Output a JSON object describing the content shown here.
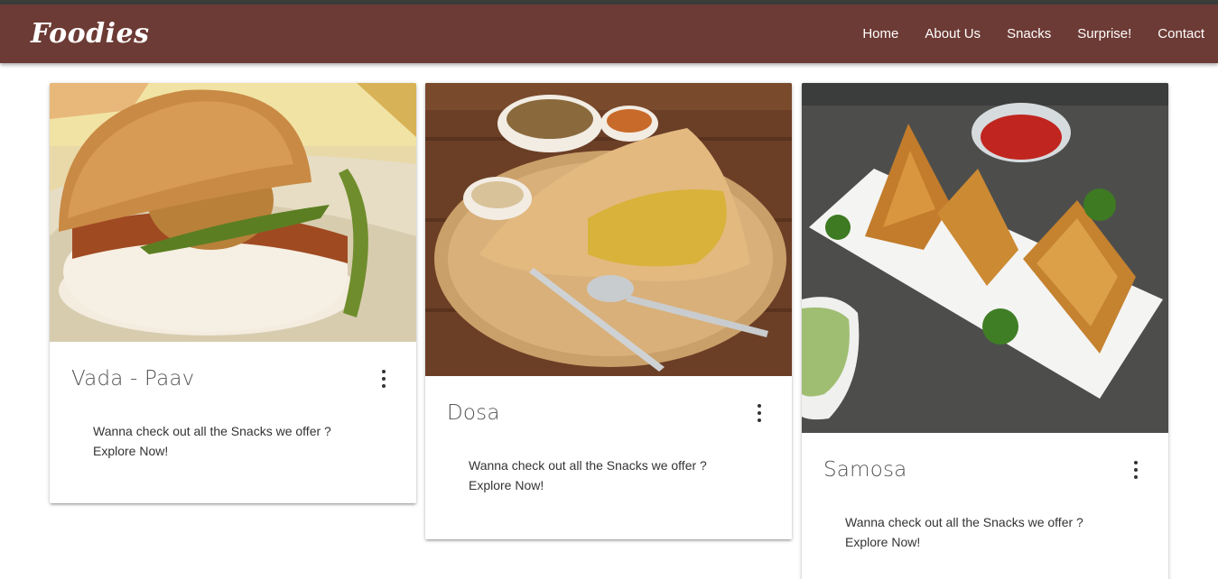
{
  "brand": "Foodies",
  "nav": {
    "items": [
      "Home",
      "About Us",
      "Snacks",
      "Surprise!",
      "Contact"
    ]
  },
  "cards": [
    {
      "title": "Vada - Paav",
      "text_line1": "Wanna check out all the Snacks we offer ?",
      "text_line2": "Explore Now!"
    },
    {
      "title": "Dosa",
      "text_line1": "Wanna check out all the Snacks we offer ?",
      "text_line2": "Explore Now!"
    },
    {
      "title": "Samosa",
      "text_line1": "Wanna check out all the Snacks we offer ?",
      "text_line2": "Explore Now!"
    }
  ],
  "icons": {
    "card_menu": "more-vert-icon"
  },
  "colors": {
    "navbar": "#6d3b35",
    "nav_text": "#ffffff",
    "card_title": "#555555",
    "card_text": "#333333"
  }
}
